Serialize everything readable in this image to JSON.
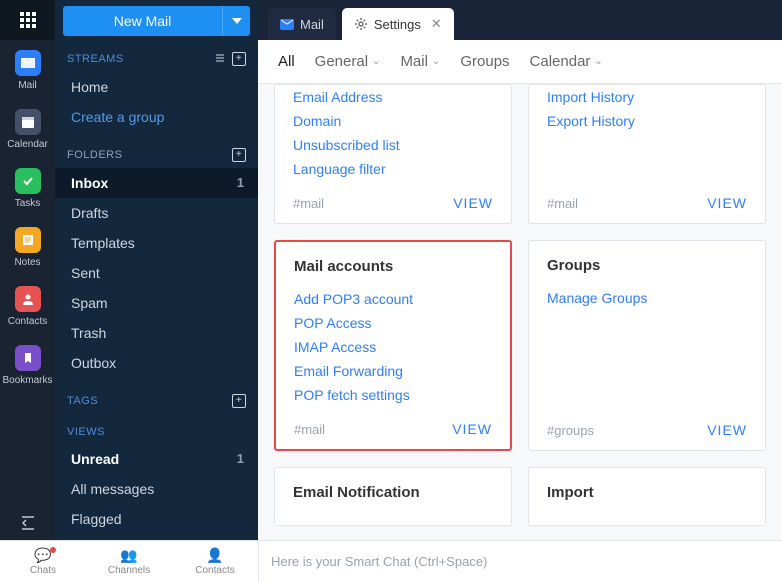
{
  "rail": {
    "items": [
      {
        "label": "Mail"
      },
      {
        "label": "Calendar"
      },
      {
        "label": "Tasks"
      },
      {
        "label": "Notes"
      },
      {
        "label": "Contacts"
      },
      {
        "label": "Bookmarks"
      }
    ]
  },
  "sidebar": {
    "newmail": "New Mail",
    "sections": {
      "streams": {
        "label": "STREAMS",
        "items": [
          {
            "label": "Home"
          },
          {
            "label": "Create a group"
          }
        ]
      },
      "folders": {
        "label": "FOLDERS",
        "items": [
          {
            "label": "Inbox",
            "count": "1"
          },
          {
            "label": "Drafts"
          },
          {
            "label": "Templates"
          },
          {
            "label": "Sent"
          },
          {
            "label": "Spam"
          },
          {
            "label": "Trash"
          },
          {
            "label": "Outbox"
          }
        ]
      },
      "tags": {
        "label": "TAGS"
      },
      "views": {
        "label": "VIEWS",
        "items": [
          {
            "label": "Unread",
            "count": "1"
          },
          {
            "label": "All messages"
          },
          {
            "label": "Flagged"
          }
        ]
      }
    }
  },
  "tabs": [
    {
      "label": "Mail"
    },
    {
      "label": "Settings"
    }
  ],
  "filters": [
    {
      "label": "All"
    },
    {
      "label": "General"
    },
    {
      "label": "Mail"
    },
    {
      "label": "Groups"
    },
    {
      "label": "Calendar"
    }
  ],
  "cards": {
    "left": [
      {
        "title": "",
        "links": [
          "Email Address",
          "Domain",
          "Unsubscribed list",
          "Language filter"
        ],
        "tag": "#mail",
        "view": "VIEW",
        "cuttop": true
      },
      {
        "title": "Mail accounts",
        "links": [
          "Add POP3 account",
          "POP Access",
          "IMAP Access",
          "Email Forwarding",
          "POP fetch settings"
        ],
        "tag": "#mail",
        "view": "VIEW",
        "highlight": true
      },
      {
        "title": "Email Notification"
      }
    ],
    "right": [
      {
        "title": "",
        "links": [
          "Import History",
          "Export History"
        ],
        "tag": "#mail",
        "view": "VIEW",
        "cuttop": true
      },
      {
        "title": "Groups",
        "links": [
          "Manage Groups"
        ],
        "tag": "#groups",
        "view": "VIEW"
      },
      {
        "title": "Import"
      }
    ]
  },
  "bottombar": {
    "items": [
      {
        "label": "Chats"
      },
      {
        "label": "Channels"
      },
      {
        "label": "Contacts"
      }
    ],
    "smartchat": "Here is your Smart Chat (Ctrl+Space)"
  }
}
